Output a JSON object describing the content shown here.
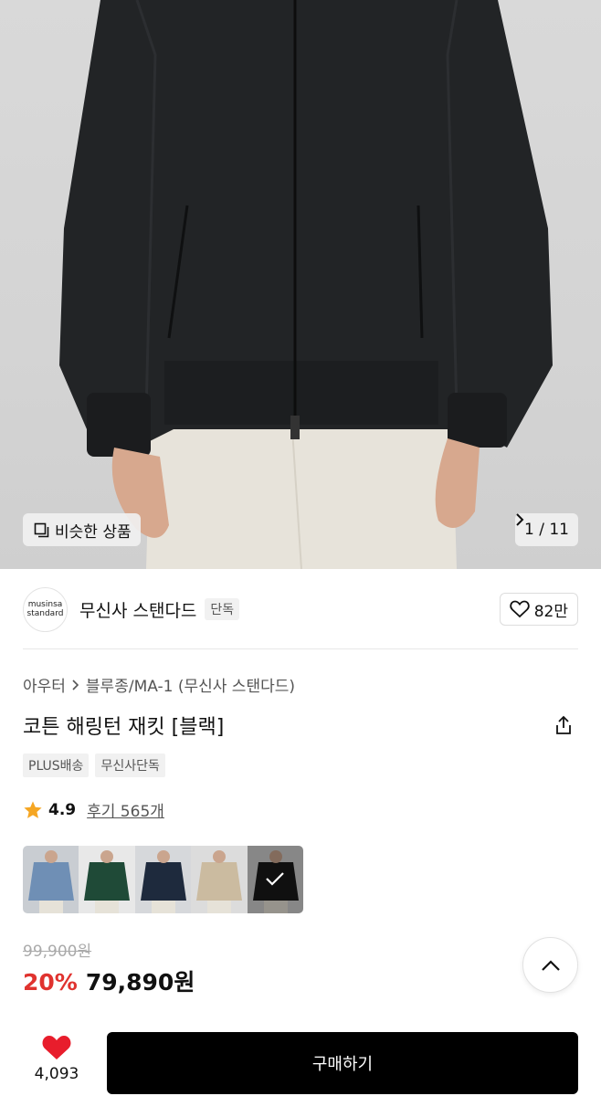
{
  "hero": {
    "similar_label": "비슷한 상품",
    "counter": "1 / 11"
  },
  "brand": {
    "logo_line1": "musinsa",
    "logo_line2": "standard",
    "name": "무신사 스탠다드",
    "badge": "단독",
    "likes": "82만"
  },
  "breadcrumb": {
    "category": "아우터",
    "subcategory": "블루종/MA-1 (무신사 스탠다드)"
  },
  "product": {
    "title": "코튼 해링턴 재킷 [블랙]",
    "tags": [
      "PLUS배송",
      "무신사단독"
    ],
    "rating": "4.9",
    "reviews": "후기 565개"
  },
  "swatches": {
    "colors": [
      "#6f8fb5",
      "#1f4a37",
      "#1e2a3d",
      "#cbbba0",
      "#1a1a1a"
    ],
    "selected_index": 4
  },
  "pricing": {
    "original": "99,900원",
    "discount": "20%",
    "price": "79,890원"
  },
  "bottom_bar": {
    "like_count": "4,093",
    "buy_label": "구매하기"
  },
  "colors": {
    "accent_red": "#e0332f",
    "heart_red": "#e81d2c",
    "buy_button": "#000000"
  }
}
